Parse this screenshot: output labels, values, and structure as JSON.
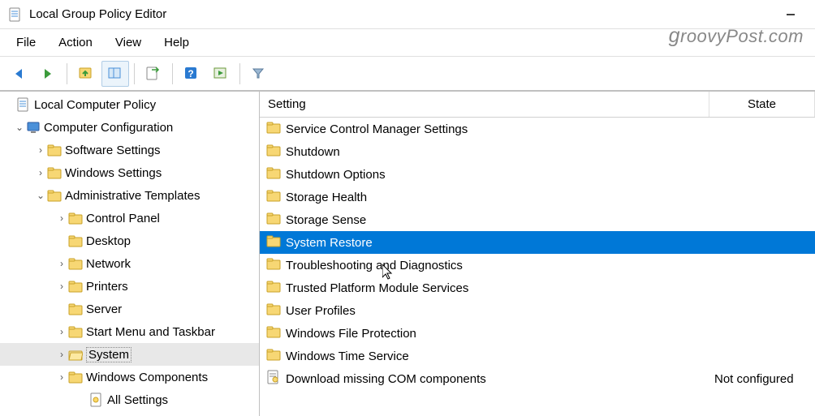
{
  "window": {
    "title": "Local Group Policy Editor"
  },
  "menubar": [
    "File",
    "Action",
    "View",
    "Help"
  ],
  "tree": [
    {
      "depth": 0,
      "exp": "",
      "icon": "doc",
      "label": "Local Computer Policy",
      "sel": false
    },
    {
      "depth": 1,
      "exp": "v",
      "icon": "pc",
      "label": "Computer Configuration",
      "sel": false
    },
    {
      "depth": 2,
      "exp": ">",
      "icon": "folder",
      "label": "Software Settings",
      "sel": false
    },
    {
      "depth": 2,
      "exp": ">",
      "icon": "folder",
      "label": "Windows Settings",
      "sel": false
    },
    {
      "depth": 2,
      "exp": "v",
      "icon": "folder",
      "label": "Administrative Templates",
      "sel": false
    },
    {
      "depth": 3,
      "exp": ">",
      "icon": "folder",
      "label": "Control Panel",
      "sel": false
    },
    {
      "depth": 3,
      "exp": "",
      "icon": "folder",
      "label": "Desktop",
      "sel": false
    },
    {
      "depth": 3,
      "exp": ">",
      "icon": "folder",
      "label": "Network",
      "sel": false
    },
    {
      "depth": 3,
      "exp": ">",
      "icon": "folder",
      "label": "Printers",
      "sel": false
    },
    {
      "depth": 3,
      "exp": "",
      "icon": "folder",
      "label": "Server",
      "sel": false
    },
    {
      "depth": 3,
      "exp": ">",
      "icon": "folder",
      "label": "Start Menu and Taskbar",
      "sel": false
    },
    {
      "depth": 3,
      "exp": ">",
      "icon": "folder-open",
      "label": "System",
      "sel": true
    },
    {
      "depth": 3,
      "exp": ">",
      "icon": "folder",
      "label": "Windows Components",
      "sel": false
    },
    {
      "depth": 4,
      "exp": "",
      "icon": "settings",
      "label": "All Settings",
      "sel": false
    }
  ],
  "columns": {
    "setting": "Setting",
    "state": "State"
  },
  "items": [
    {
      "icon": "folder",
      "setting": "Service Control Manager Settings",
      "state": "",
      "sel": false
    },
    {
      "icon": "folder",
      "setting": "Shutdown",
      "state": "",
      "sel": false
    },
    {
      "icon": "folder",
      "setting": "Shutdown Options",
      "state": "",
      "sel": false
    },
    {
      "icon": "folder",
      "setting": "Storage Health",
      "state": "",
      "sel": false
    },
    {
      "icon": "folder",
      "setting": "Storage Sense",
      "state": "",
      "sel": false
    },
    {
      "icon": "folder",
      "setting": "System Restore",
      "state": "",
      "sel": true
    },
    {
      "icon": "folder",
      "setting": "Troubleshooting and Diagnostics",
      "state": "",
      "sel": false
    },
    {
      "icon": "folder",
      "setting": "Trusted Platform Module Services",
      "state": "",
      "sel": false
    },
    {
      "icon": "folder",
      "setting": "User Profiles",
      "state": "",
      "sel": false
    },
    {
      "icon": "folder",
      "setting": "Windows File Protection",
      "state": "",
      "sel": false
    },
    {
      "icon": "folder",
      "setting": "Windows Time Service",
      "state": "",
      "sel": false
    },
    {
      "icon": "policy",
      "setting": "Download missing COM components",
      "state": "Not configured",
      "sel": false
    }
  ],
  "watermark": "groovyPost.com"
}
